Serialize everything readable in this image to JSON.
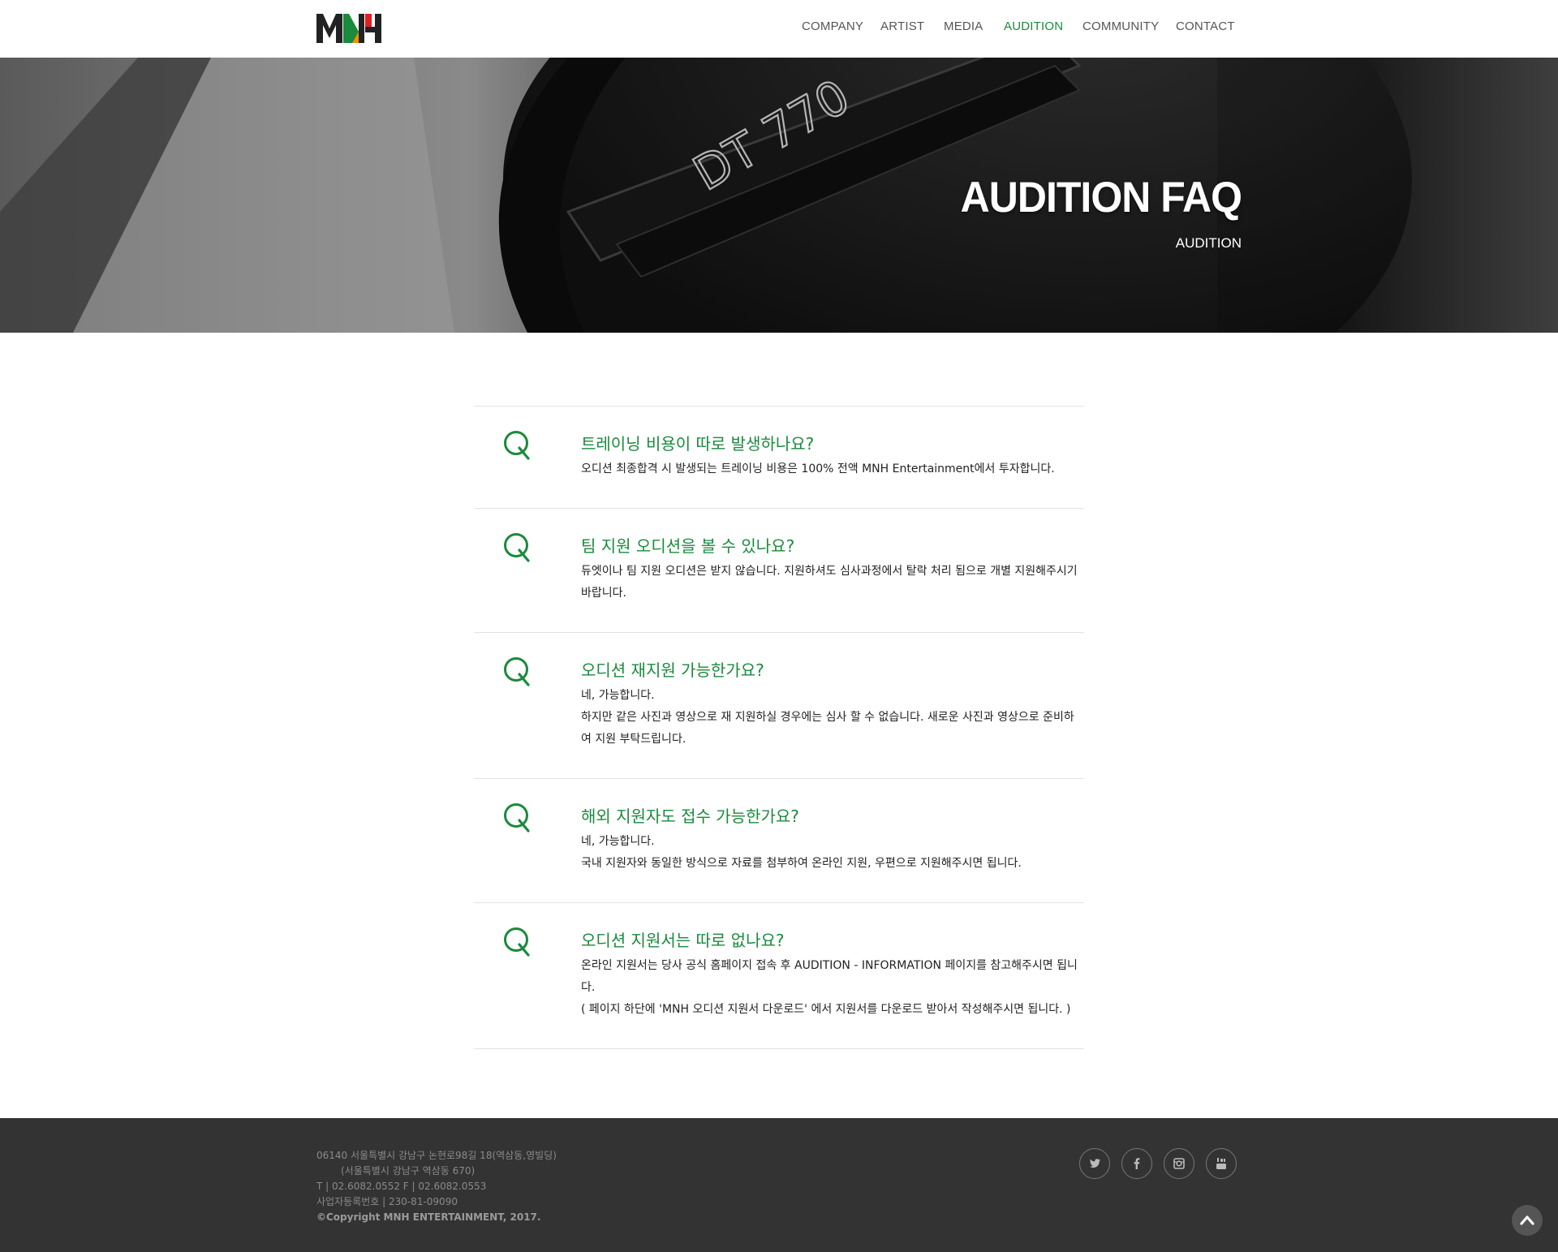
{
  "brand": {
    "logo_text": "MNH",
    "colors": {
      "green": "#1a8a3c",
      "red": "#e31e24",
      "orange": "#f39200",
      "dark": "#222222"
    }
  },
  "nav": {
    "items": [
      {
        "label": "COMPANY",
        "active": false
      },
      {
        "label": "ARTIST",
        "active": false
      },
      {
        "label": "MEDIA",
        "active": false
      },
      {
        "label": "AUDITION",
        "active": true
      },
      {
        "label": "COMMUNITY",
        "active": false
      },
      {
        "label": "CONTACT",
        "active": false
      }
    ]
  },
  "hero": {
    "title": "AUDITION FAQ",
    "subtitle": "AUDITION",
    "image_text": "DT 770"
  },
  "faq": {
    "items": [
      {
        "mark": "Q",
        "question": "트레이닝 비용이 따로 발생하나요?",
        "answer": [
          "오디션 최종합격 시 발생되는 트레이닝 비용은 100% 전액 MNH Entertainment에서 투자합니다."
        ]
      },
      {
        "mark": "Q",
        "question": "팀 지원 오디션을 볼 수 있나요?",
        "answer": [
          "듀엣이나 팀 지원 오디션은 받지 않습니다. 지원하셔도 심사과정에서 탈락 처리 됨으로 개별 지원해주시기 바랍니다."
        ]
      },
      {
        "mark": "Q",
        "question": "오디션 재지원 가능한가요?",
        "answer": [
          "네, 가능합니다.",
          "하지만 같은 사진과 영상으로 재 지원하실 경우에는 심사 할 수 없습니다. 새로운 사진과 영상으로 준비하여 지원 부탁드립니다."
        ]
      },
      {
        "mark": "Q",
        "question": "해외 지원자도 접수 가능한가요?",
        "answer": [
          "네, 가능합니다.",
          "국내 지원자와 동일한 방식으로 자료를 첨부하여 온라인 지원, 우편으로 지원해주시면 됩니다."
        ]
      },
      {
        "mark": "Q",
        "question": "오디션 지원서는 따로 없나요?",
        "answer": [
          "온라인 지원서는 당사 공식 홈페이지 접속 후 AUDITION - INFORMATION 페이지를 참고해주시면 됩니다.",
          "( 페이지 하단에 'MNH 오디션 지원서 다운로드' 에서 지원서를 다운로드 받아서 작성해주시면 됩니다. )"
        ]
      }
    ]
  },
  "footer": {
    "address_line1": "06140  서울특별시 강남구 논현로98길 18(역삼동,영빌딩)",
    "address_line2": "(서울특별시 강남구 역삼동 670)",
    "phone_line": "T | 02.6082.0552   F | 02.6082.0553",
    "business_line": "사업자등록번호 | 230-81-09090",
    "copyright": "©Copyright MNH ENTERTAINMENT, 2017.",
    "social": [
      "twitter-icon",
      "facebook-icon",
      "instagram-icon",
      "youtube-icon"
    ]
  }
}
